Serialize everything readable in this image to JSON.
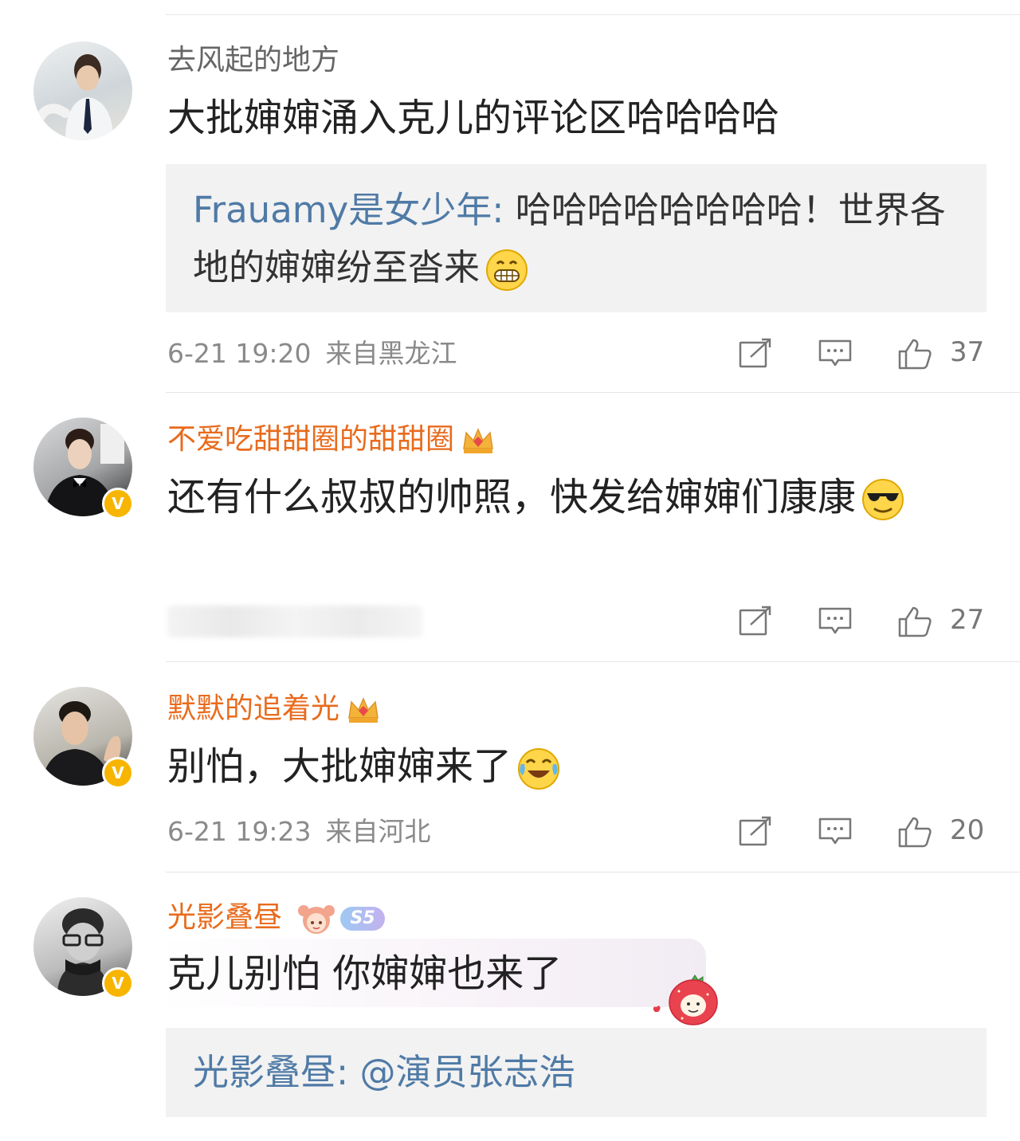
{
  "comments": [
    {
      "username": "去风起的地方",
      "text": "大批婶婶涌入克儿的评论区哈哈哈哈",
      "quote_name": "Frauamy是女少年:",
      "quote_text": " 哈哈哈哈哈哈哈哈！世界各地的婶婶纷至沓来",
      "date": "6-21 19:20",
      "location": "来自黑龙江",
      "likes": "37"
    },
    {
      "username": "不爱吃甜甜圈的甜甜圈",
      "text": "还有什么叔叔的帅照，快发给婶婶们康康",
      "likes": "27"
    },
    {
      "username": "默默的追着光",
      "text": "别怕，大批婶婶来了",
      "date": "6-21 19:23",
      "location": "来自河北",
      "likes": "20"
    },
    {
      "username": "光影叠昼",
      "badge": "S5",
      "text": "克儿别怕 你婶婶也来了",
      "quote_name": "光影叠昼:",
      "quote_text": " @演员张志浩"
    }
  ],
  "icons": {
    "repost": "repost-icon",
    "comment": "comment-icon",
    "like": "like-icon",
    "verified": "verified-v-icon",
    "vip": "crown-icon"
  },
  "colors": {
    "username_gray": "#666666",
    "username_vip": "#e86b1d",
    "quote_name": "#4f7aa6",
    "verified_badge": "#f7b500"
  }
}
